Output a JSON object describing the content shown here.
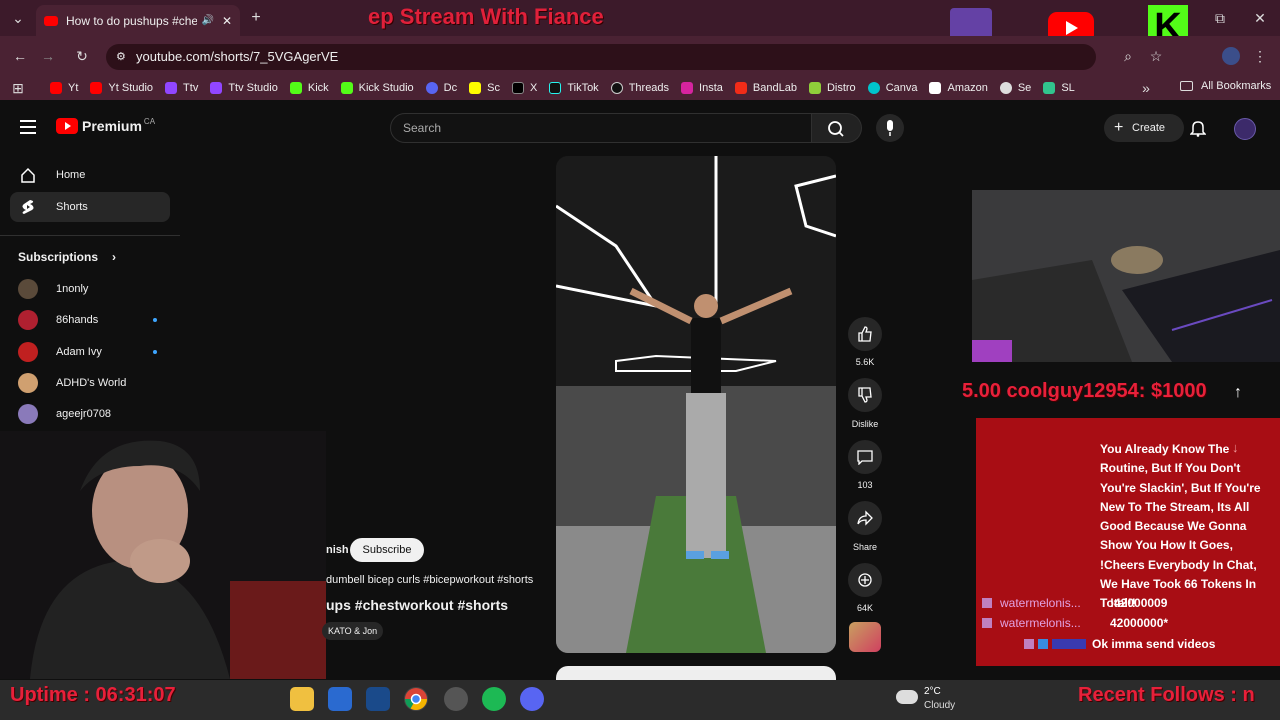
{
  "browser": {
    "tab_title": "How to do pushups #chestw",
    "url": "youtube.com/shorts/7_5VGAgerVE",
    "all_bookmarks": "All Bookmarks",
    "bookmarks": [
      "Yt",
      "Yt Studio",
      "Ttv",
      "Ttv Studio",
      "Kick",
      "Kick Studio",
      "Dc",
      "Sc",
      "X",
      "TikTok",
      "Threads",
      "Insta",
      "BandLab",
      "Distro",
      "Canva",
      "Amazon",
      "Se",
      "SL"
    ]
  },
  "overlay": {
    "stream_title": "ep Stream With Fiance",
    "donation_ticker": "5.00   coolguy12954: $1000",
    "uptime": "Uptime : 06:31:07",
    "recent_follows": "Recent Follows : n",
    "chat": {
      "intro": "You Already Know The Routine, But If You Don't You're Slackin', But If You're New To The Stream, Its All Good Because We Gonna Show You How It Goes, !Cheers Everybody In Chat, We Have Took 66 Tokens In Total!!",
      "messages": [
        {
          "user": "watermelonis...",
          "text": "!42000009"
        },
        {
          "user": "watermelonis...",
          "text": "42000000*"
        },
        {
          "user": "",
          "text": "Ok imma send videos"
        }
      ]
    }
  },
  "youtube": {
    "logo": "Premium",
    "region": "CA",
    "search_placeholder": "Search",
    "create_label": "Create",
    "nav": [
      {
        "label": "Home",
        "icon": "home-icon"
      },
      {
        "label": "Shorts",
        "icon": "shorts-icon"
      }
    ],
    "subscriptions_label": "Subscriptions",
    "subscriptions": [
      {
        "name": "1nonly",
        "dot": false,
        "color": "#5a4a3a"
      },
      {
        "name": "86hands",
        "dot": true,
        "color": "#b02030"
      },
      {
        "name": "Adam Ivy",
        "dot": true,
        "color": "#c02020"
      },
      {
        "name": "ADHD's World",
        "dot": false,
        "color": "#d0a070"
      },
      {
        "name": "ageejr0708",
        "dot": false,
        "color": "#8a7aba"
      }
    ],
    "short": {
      "channel_partial": "nish",
      "subscribe_label": "Subscribe",
      "suggested": "dumbell bicep curls #bicepworkout #shorts",
      "title": "ups #chestworkout #shorts",
      "music": "KATO & Jon"
    },
    "actions": {
      "likes": "5.6K",
      "dislike": "Dislike",
      "comments": "103",
      "share": "Share",
      "remix": "64K"
    }
  },
  "taskbar": {
    "temperature": "2°C",
    "weather": "Cloudy"
  }
}
